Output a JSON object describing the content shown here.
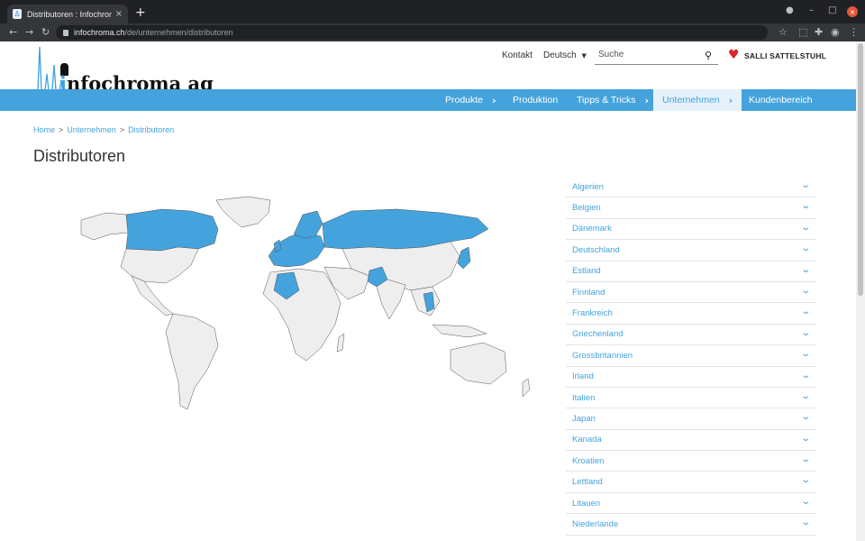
{
  "browser": {
    "tab_title": "Distributoren : Infochroma",
    "tab_close": "×",
    "new_tab": "+",
    "url_host": "infochroma.ch",
    "url_path": "/de/unternehmen/distributoren",
    "minimize": "–",
    "maximize": "□",
    "close": "×"
  },
  "header": {
    "logo_i": "i",
    "logo_rest": "nfochroma ag",
    "contact": "Kontakt",
    "language": "Deutsch",
    "search_placeholder": "Suche",
    "salli": "SALLI SATTELSTUHL"
  },
  "nav": {
    "items": [
      {
        "label": "Produkte",
        "has_chevron": true
      },
      {
        "label": "Produktion",
        "has_chevron": false
      },
      {
        "label": "Tipps & Tricks",
        "has_chevron": true
      },
      {
        "label": "Unternehmen",
        "has_chevron": true
      },
      {
        "label": "Kundenbereich",
        "has_chevron": false
      }
    ]
  },
  "breadcrumb": {
    "home": "Home",
    "sep1": ">",
    "section": "Unternehmen",
    "sep2": ">",
    "current": "Distributoren"
  },
  "page_title": "Distributoren",
  "colors": {
    "accent": "#44a3dc",
    "map_highlight": "#44a3dc",
    "map_land": "#eeeeee"
  },
  "countries": [
    "Algerien",
    "Belgien",
    "Dänemark",
    "Deutschland",
    "Estland",
    "Finnland",
    "Frankreich",
    "Griechenland",
    "Grossbritannien",
    "Irland",
    "Italien",
    "Japan",
    "Kanada",
    "Kroatien",
    "Lettland",
    "Litauen",
    "Niederlande"
  ]
}
